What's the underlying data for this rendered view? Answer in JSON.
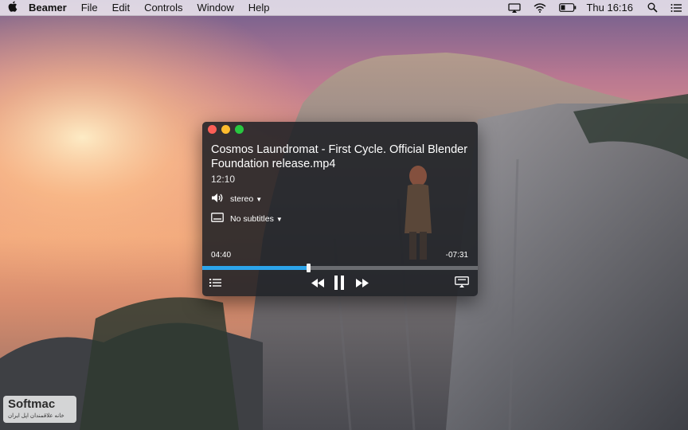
{
  "menubar": {
    "apple_icon": "apple-icon",
    "app_name": "Beamer",
    "items": [
      "File",
      "Edit",
      "Controls",
      "Window",
      "Help"
    ],
    "status_icons": [
      "airplay-icon",
      "wifi-icon",
      "battery-icon"
    ],
    "clock": "Thu 16:16",
    "search_icon": "search-icon",
    "notification_icon": "list-icon"
  },
  "player": {
    "title": "Cosmos Laundromat - First Cycle. Official Blender Foundation release.mp4",
    "duration": "12:10",
    "audio": {
      "icon": "speaker-icon",
      "value": "stereo"
    },
    "subtitles": {
      "icon": "subtitles-icon",
      "value": "No subtitles"
    },
    "elapsed": "04:40",
    "remaining": "-07:31",
    "progress_percent": 38.4,
    "accent_color": "#2ca4ea",
    "controls": [
      "playlist-icon",
      "rewind-icon",
      "pause-icon",
      "fast-forward-icon",
      "airplay-screen-icon"
    ]
  },
  "watermark": {
    "brand": "Softmac",
    "subtitle": "خانه علاقمندان اپل ایران"
  }
}
